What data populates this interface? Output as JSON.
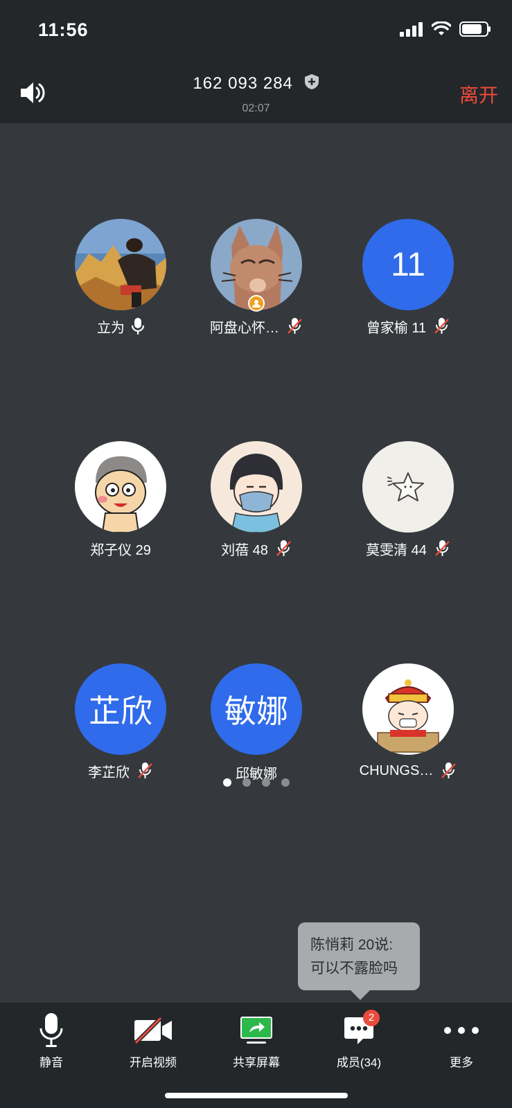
{
  "status_bar": {
    "time": "11:56"
  },
  "header": {
    "meeting_id": "162 093 284",
    "duration": "02:07",
    "leave_label": "离开"
  },
  "participants": [
    {
      "name": "立为",
      "mic": "on",
      "avatar": "photo-mountain"
    },
    {
      "name": "阿盘心怀…",
      "mic": "muted",
      "avatar": "cartoon-rabbit",
      "host": true
    },
    {
      "name": "曾家榆 11",
      "mic": "muted",
      "avatar_text": "11"
    },
    {
      "name": "郑子仪 29",
      "mic": "none",
      "avatar": "cartoon-boy"
    },
    {
      "name": "刘蓓 48",
      "mic": "muted",
      "avatar": "cartoon-mask-girl"
    },
    {
      "name": "莫雯清 44",
      "mic": "muted",
      "avatar": "star-sketch"
    },
    {
      "name": "李芷欣",
      "mic": "muted",
      "avatar_text": "芷欣"
    },
    {
      "name": "邱敏娜",
      "mic": "none",
      "avatar_text": "敏娜"
    },
    {
      "name": "CHUNGS…",
      "mic": "muted",
      "avatar": "cartoon-emperor"
    }
  ],
  "pager": {
    "pages": 4,
    "active": 1
  },
  "chat_toast": {
    "line1": "陈悄莉 20说:",
    "line2": "可以不露脸吗"
  },
  "toolbar": {
    "mute_label": "静音",
    "video_label": "开启视频",
    "share_label": "共享屏幕",
    "members_label": "成员(34)",
    "members_badge": "2",
    "more_label": "更多"
  },
  "colors": {
    "background": "#35393d",
    "bar": "#23272a",
    "accent_blue": "#2f6bea",
    "leave_red": "#f04a3a",
    "share_green": "#2db84c"
  }
}
